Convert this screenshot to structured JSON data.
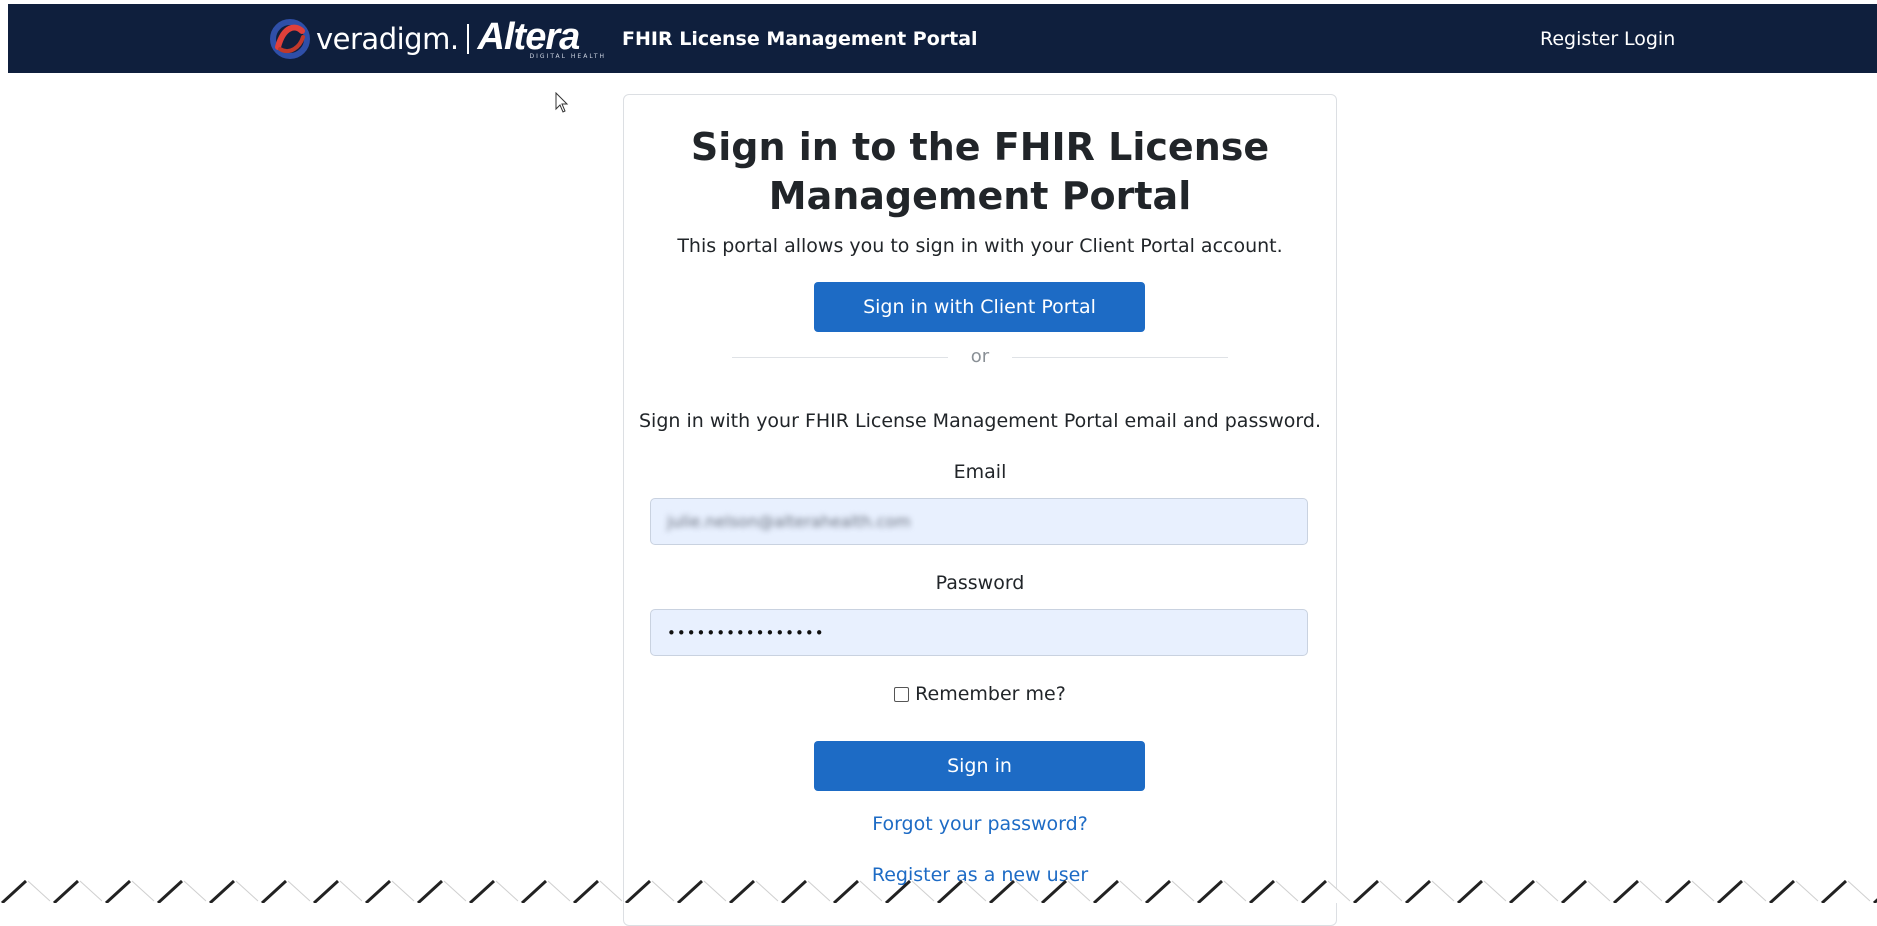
{
  "header": {
    "brand_name": "veradigm.",
    "partner_name": "Altera",
    "partner_tagline": "DIGITAL HEALTH",
    "portal_title": "FHIR License Management Portal",
    "nav": {
      "register": "Register",
      "login": "Login"
    }
  },
  "signin": {
    "title_line1": "Sign in to the FHIR License",
    "title_line2": "Management Portal",
    "intro": "This portal allows you to sign in with your Client Portal account.",
    "client_portal_button": "Sign in with Client Portal",
    "divider_text": "or",
    "local_intro": "Sign in with your FHIR License Management Portal email and password.",
    "email_label": "Email",
    "email_value": "julie.nelson@alterahealth.com",
    "password_label": "Password",
    "password_value": "••••••••••••••••",
    "remember_label": "Remember me?",
    "remember_checked": false,
    "signin_button": "Sign in",
    "forgot_link": "Forgot your password?",
    "register_link": "Register as a new user"
  },
  "colors": {
    "navbar_bg": "#0f1f3d",
    "primary": "#1d6bc5",
    "input_bg": "#e8f0fe",
    "logo_red": "#e0403a",
    "logo_blue": "#2f4fa8"
  }
}
